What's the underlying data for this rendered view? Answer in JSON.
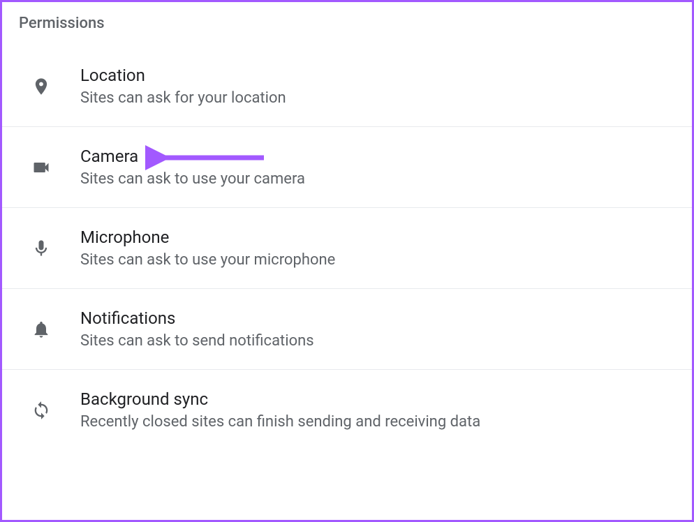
{
  "section_title": "Permissions",
  "permissions": [
    {
      "id": "location",
      "title": "Location",
      "description": "Sites can ask for your location"
    },
    {
      "id": "camera",
      "title": "Camera",
      "description": "Sites can ask to use your camera"
    },
    {
      "id": "microphone",
      "title": "Microphone",
      "description": "Sites can ask to use your microphone"
    },
    {
      "id": "notifications",
      "title": "Notifications",
      "description": "Sites can ask to send notifications"
    },
    {
      "id": "background-sync",
      "title": "Background sync",
      "description": "Recently closed sites can finish sending and receiving data"
    }
  ],
  "annotation": {
    "target": "camera",
    "color": "#a259ff"
  }
}
